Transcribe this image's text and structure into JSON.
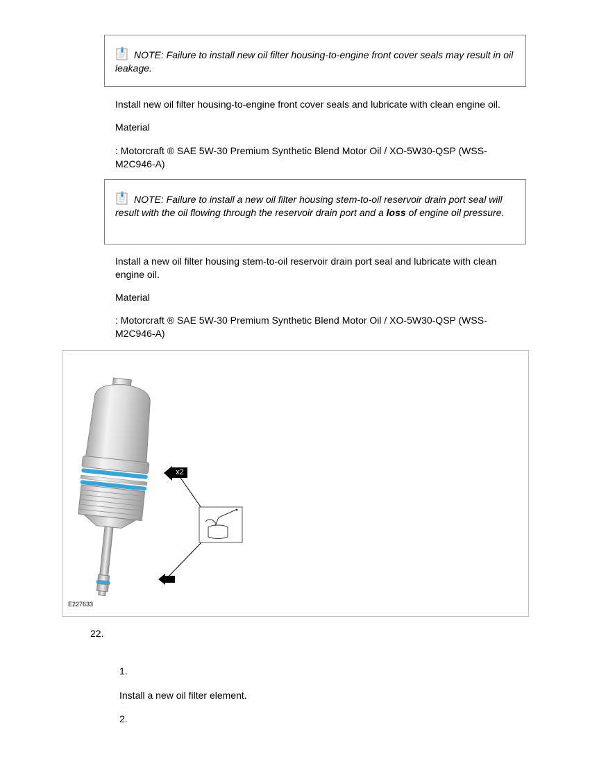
{
  "note1": {
    "text": "NOTE: Failure to install new oil filter housing-to-engine front cover seals may result in oil leakage."
  },
  "step_seals": {
    "instruction": "Install new oil filter housing-to-engine front cover seals and lubricate with clean engine oil.",
    "material_label": "Material",
    "material_value": ": Motorcraft ® SAE 5W-30 Premium Synthetic Blend Motor Oil / XO-5W30-QSP (WSS-M2C946-A)"
  },
  "note2": {
    "text_before": "NOTE: Failure to install a new oil filter housing stem-to-oil reservoir drain port seal will result with the oil flowing through the reservoir drain port and a ",
    "bold_word": "loss",
    "text_after": "  of engine oil pressure."
  },
  "step_drain": {
    "instruction": "Install a new oil filter housing stem-to-oil reservoir drain port seal and lubricate with clean engine oil.",
    "material_label": "Material",
    "material_value": ": Motorcraft ® SAE 5W-30 Premium Synthetic Blend Motor Oil / XO-5W30-QSP (WSS-M2C946-A)"
  },
  "figure": {
    "callout_label": "x2",
    "code": "E227633",
    "seal_color": "#3aa3d8"
  },
  "step22": {
    "number": "22.",
    "sub1_number": "1.",
    "sub1_text": "Install a new oil filter element.",
    "sub2_number": "2."
  },
  "icons": {
    "note": "note-clipboard-icon",
    "oil_can": "oil-can-icon",
    "callout_arrow": "arrow-left-icon"
  }
}
